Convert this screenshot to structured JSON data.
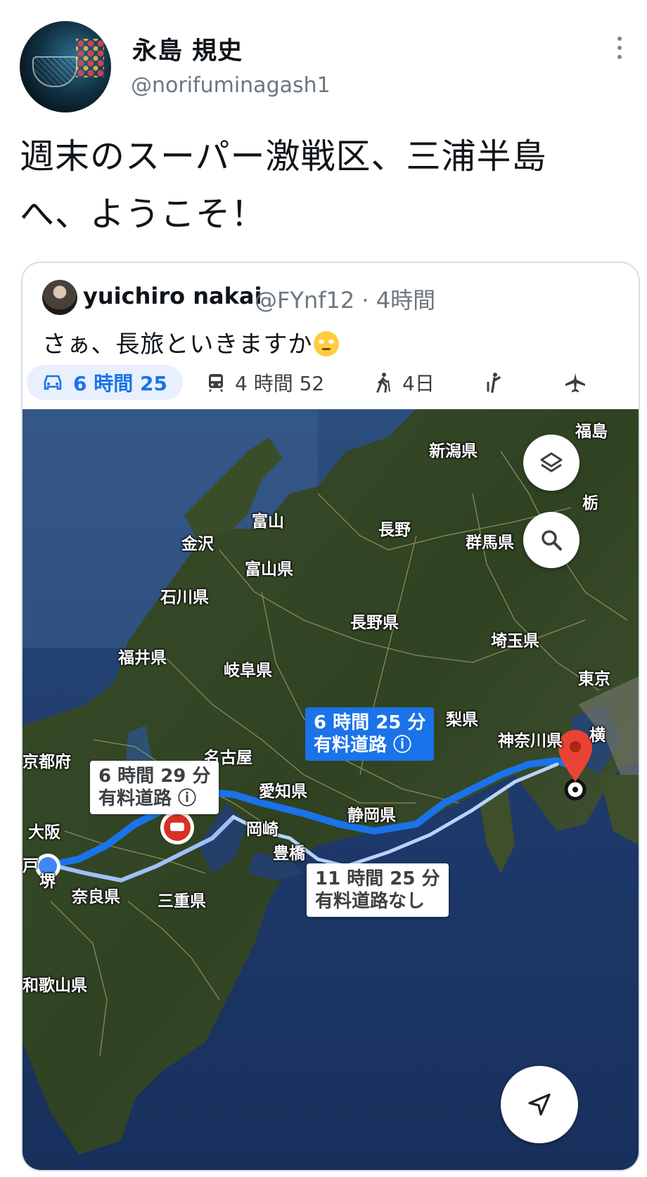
{
  "tweet": {
    "author_name": "永島 規史",
    "author_handle": "@norifuminagash1",
    "text_line1": "週末のスーパー激戦区、三浦半島",
    "text_line2": "へ、ようこそ！"
  },
  "quoted": {
    "author_name": "yuichiro nakai",
    "author_handle": "@FYnf12 · 4時間",
    "text": "さぁ、長旅といきますか",
    "emoji": "face-with-rolling-eyes"
  },
  "map": {
    "tabs": [
      {
        "icon": "car-icon",
        "label": "6 時間 25",
        "selected": true
      },
      {
        "icon": "transit-icon",
        "label": "4 時間 52",
        "selected": false
      },
      {
        "icon": "walk-icon",
        "label": "4日",
        "selected": false
      },
      {
        "icon": "ride-icon",
        "label": "",
        "selected": false
      },
      {
        "icon": "flight-icon",
        "label": "",
        "selected": false
      }
    ],
    "place_labels": {
      "fukushima": "福島",
      "niigata": "新潟県",
      "tochigi": "栃",
      "toyama_city": "富山",
      "nagano_city": "長野",
      "kanazawa": "金沢",
      "gunma": "群馬県",
      "toyama_pref": "富山県",
      "ishikawa": "石川県",
      "nagano_pref": "長野県",
      "saitama": "埼玉県",
      "fukui": "福井県",
      "gifu": "岐阜県",
      "tokyo": "東京",
      "yamanashi": "梨県",
      "kanagawa": "神奈川県",
      "yokohama": "横",
      "kyoto": "京都府",
      "nagoya": "名古屋",
      "aichi": "愛知県",
      "shizuoka": "静岡県",
      "osaka": "大阪",
      "okazaki": "岡崎",
      "toyohashi": "豊橋",
      "sakai": "堺",
      "kobe": "戸",
      "nara": "奈良県",
      "mie": "三重県",
      "wakayama": "和歌山県"
    },
    "routes": {
      "main": {
        "time": "6 時間 25 分",
        "note": "有料道路 ⓘ"
      },
      "alt1": {
        "time": "6 時間 29 分",
        "note": "有料道路 ⓘ"
      },
      "alt2": {
        "time": "11 時間 25 分",
        "note": "有料道路なし"
      }
    },
    "colors": {
      "route": "#1a73e8",
      "route_alt": "#8ab4f8",
      "pin": "#ea4335",
      "origin": "#4285f4"
    }
  }
}
